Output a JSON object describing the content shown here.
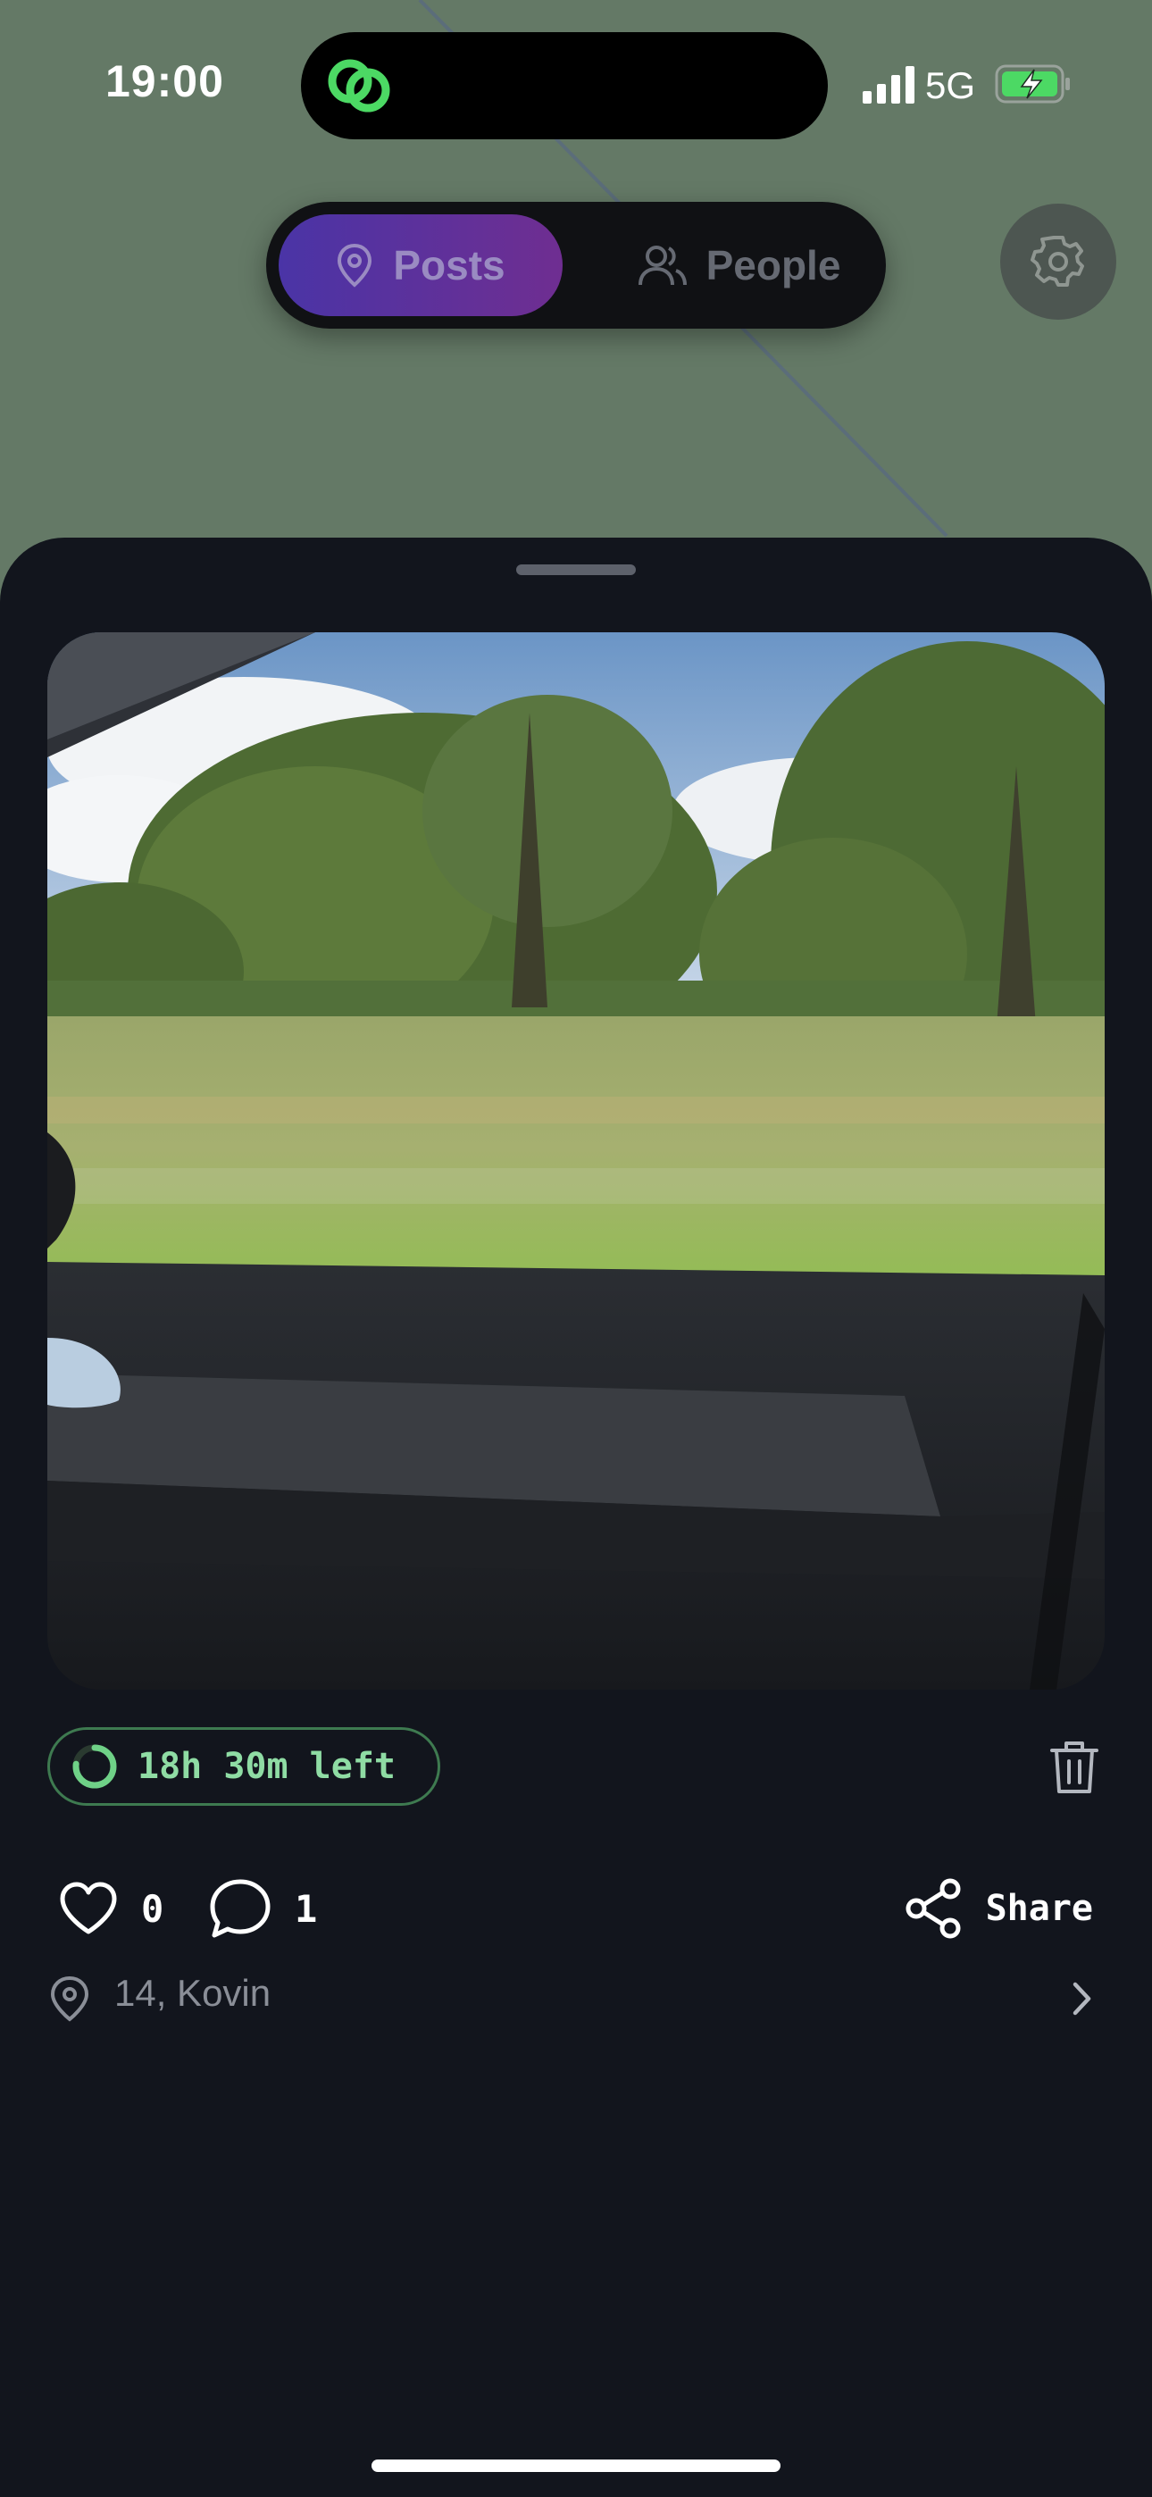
{
  "status_bar": {
    "time": "19:00",
    "network": "5G",
    "icons": [
      "app-logo-icon",
      "signal-icon",
      "battery-charging-icon"
    ]
  },
  "tabs": {
    "posts_label": "Posts",
    "people_label": "People",
    "active": "Posts"
  },
  "post": {
    "time_left": "18h 30m left",
    "time_left_fraction": 0.77,
    "likes": "0",
    "comments": "1",
    "share_label": "Share",
    "location": "14, Kovin"
  },
  "colors": {
    "map_background": "#647966",
    "sheet_background": "#12151d",
    "accent_purple": "#5b2fa0",
    "timer_green": "#8fdca4",
    "logo_green": "#4cd964"
  }
}
